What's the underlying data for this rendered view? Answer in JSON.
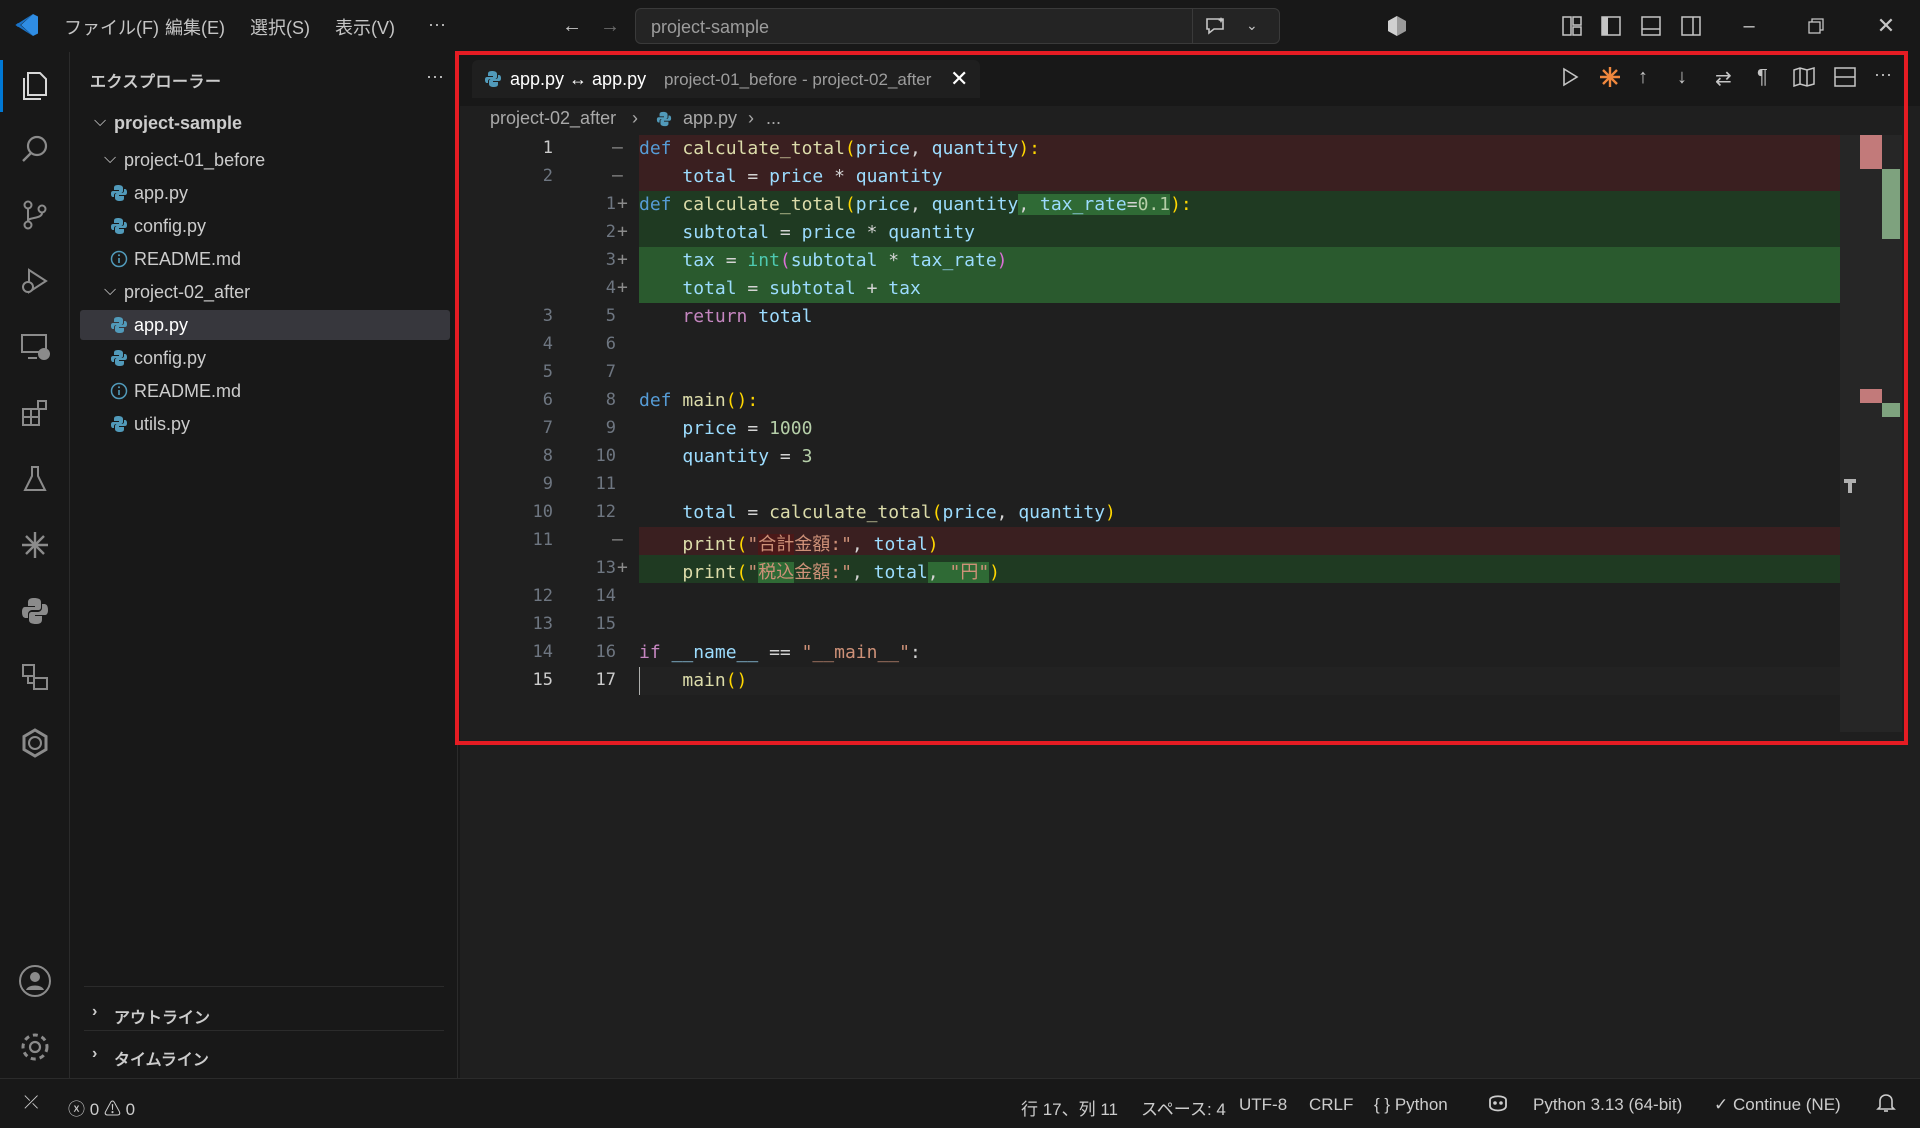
{
  "titlebar": {
    "menu": [
      "ファイル(F)",
      "編集(E)",
      "選択(S)",
      "表示(V)",
      "···"
    ],
    "search_text": "project-sample"
  },
  "sidebar": {
    "title": "エクスプローラー",
    "more": "···",
    "root": "project-sample",
    "folders": [
      {
        "name": "project-01_before",
        "files": [
          "app.py",
          "config.py",
          "README.md"
        ]
      },
      {
        "name": "project-02_after",
        "files": [
          "app.py",
          "config.py",
          "README.md",
          "utils.py"
        ]
      }
    ],
    "sections": [
      "アウトライン",
      "タイムライン"
    ]
  },
  "editor": {
    "tab_name": "app.py ↔ app.py",
    "tab_desc": "project-01_before - project-02_after",
    "breadcrumb": [
      "project-02_after",
      "app.py",
      "..."
    ]
  },
  "diff_lines": [
    {
      "old": "1",
      "new": "",
      "mark": "—",
      "type": "del"
    },
    {
      "old": "2",
      "new": "",
      "mark": "—",
      "type": "del"
    },
    {
      "old": "",
      "new": "1",
      "mark": "+",
      "type": "add"
    },
    {
      "old": "",
      "new": "2",
      "mark": "+",
      "type": "add"
    },
    {
      "old": "",
      "new": "3",
      "mark": "+",
      "type": "add2"
    },
    {
      "old": "",
      "new": "4",
      "mark": "+",
      "type": "add2"
    },
    {
      "old": "3",
      "new": "5",
      "mark": "",
      "type": ""
    },
    {
      "old": "4",
      "new": "6",
      "mark": "",
      "type": ""
    },
    {
      "old": "5",
      "new": "7",
      "mark": "",
      "type": ""
    },
    {
      "old": "6",
      "new": "8",
      "mark": "",
      "type": ""
    },
    {
      "old": "7",
      "new": "9",
      "mark": "",
      "type": ""
    },
    {
      "old": "8",
      "new": "10",
      "mark": "",
      "type": ""
    },
    {
      "old": "9",
      "new": "11",
      "mark": "",
      "type": ""
    },
    {
      "old": "10",
      "new": "12",
      "mark": "",
      "type": ""
    },
    {
      "old": "11",
      "new": "",
      "mark": "—",
      "type": "del"
    },
    {
      "old": "",
      "new": "13",
      "mark": "+",
      "type": "add"
    },
    {
      "old": "12",
      "new": "14",
      "mark": "",
      "type": ""
    },
    {
      "old": "13",
      "new": "15",
      "mark": "",
      "type": ""
    },
    {
      "old": "14",
      "new": "16",
      "mark": "",
      "type": ""
    },
    {
      "old": "15",
      "new": "17",
      "mark": "",
      "type": "cur"
    }
  ],
  "code": {
    "l1": [
      "def",
      "calculate_total",
      "(",
      "price",
      ", ",
      "quantity",
      "):"
    ],
    "l2": [
      "    ",
      "total",
      " = ",
      "price",
      " * ",
      "quantity"
    ],
    "l3": [
      "def",
      "calculate_total",
      "(",
      "price",
      ", ",
      "quantity",
      ", ",
      "tax_rate",
      "=",
      "0.1",
      "):"
    ],
    "l4": [
      "    ",
      "subtotal",
      " = ",
      "price",
      " * ",
      "quantity"
    ],
    "l5": [
      "    ",
      "tax",
      " = ",
      "int",
      "(",
      "subtotal",
      " * ",
      "tax_rate",
      ")"
    ],
    "l6": [
      "    ",
      "total",
      " = ",
      "subtotal",
      " + ",
      "tax"
    ],
    "l7": [
      "    ",
      "return",
      " ",
      "total"
    ],
    "l10": [
      "def",
      "main",
      "():"
    ],
    "l11": [
      "    ",
      "price",
      " = ",
      "1000"
    ],
    "l12": [
      "    ",
      "quantity",
      " = ",
      "3"
    ],
    "l14": [
      "    ",
      "total",
      " = ",
      "calculate_total",
      "(",
      "price",
      ", ",
      "quantity",
      ")"
    ],
    "l15": [
      "    ",
      "print",
      "(",
      "\"",
      "合計",
      "金額:\"",
      ", ",
      "total",
      ")"
    ],
    "l16": [
      "    ",
      "print",
      "(",
      "\"",
      "税込",
      "金額:\"",
      ", ",
      "total",
      ", ",
      "\"円\"",
      ")"
    ],
    "l19": [
      "if",
      " ",
      "__name__",
      " == ",
      "\"__main__\"",
      ":"
    ],
    "l20": [
      "    ",
      "main",
      "()"
    ]
  },
  "statusbar": {
    "errors": "0",
    "warnings": "0",
    "position": "行 17、列 11",
    "spaces": "スペース: 4",
    "encoding": "UTF-8",
    "eol": "CRLF",
    "language": "Python",
    "interpreter": "Python 3.13 (64-bit)",
    "continue": "Continue (NE)"
  }
}
